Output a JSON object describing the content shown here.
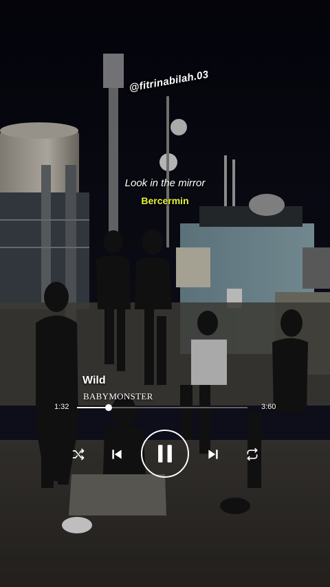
{
  "watermark": "@fitrinabilah.03",
  "lyrics": {
    "current": "Look in the mirror",
    "translation": "Bercermin"
  },
  "player": {
    "title": "Wild",
    "artist": "BABYMONSTER",
    "elapsed": "1:32",
    "total": "3:60",
    "progress": 0.185,
    "state": "playing"
  },
  "controls": {
    "shuffle_icon": "shuffle-icon",
    "prev_icon": "skip-previous-icon",
    "play_icon": "pause-icon",
    "next_icon": "skip-next-icon",
    "repeat_icon": "repeat-icon"
  },
  "colors": {
    "translation": "#e6f23a",
    "text": "#ffffff"
  }
}
